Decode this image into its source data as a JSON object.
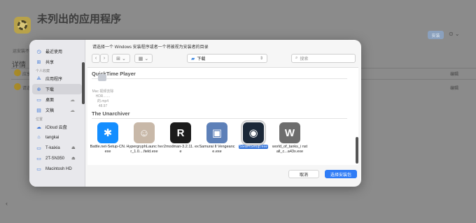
{
  "background": {
    "app_title": "未列出的应用程序",
    "install_label": "安装",
    "more_label": "⊙ ⌄",
    "side_small": "运安装不...",
    "section_title": "详情",
    "rows": [
      {
        "text": "应享...",
        "edit": "编辑"
      },
      {
        "text": "请选...",
        "edit": "编辑"
      }
    ],
    "back": "‹"
  },
  "dialog": {
    "title": "请选择一个 Windows 安装程序或者一个将被视为安装者的目录",
    "location": "下载",
    "search_placeholder": "搜索",
    "view_icons": [
      "‹",
      "›",
      "⊞ ⌄",
      "▦ ⌄"
    ],
    "cancel_label": "取消",
    "choose_label": "选择安装包"
  },
  "sidebar": {
    "items_top": [
      {
        "label": "最近使用",
        "icon": "clock-icon",
        "glyph": "◷"
      },
      {
        "label": "共享",
        "icon": "shared-icon",
        "glyph": "⊞"
      }
    ],
    "favorites_head": "个人收藏",
    "favorites": [
      {
        "label": "应用程序",
        "icon": "apps-icon",
        "glyph": "⟁"
      },
      {
        "label": "下载",
        "icon": "download-icon",
        "glyph": "⊕",
        "selected": true
      },
      {
        "label": "桌面",
        "icon": "desktop-icon",
        "glyph": "▭",
        "cloud": true
      },
      {
        "label": "文稿",
        "icon": "document-icon",
        "glyph": "▤",
        "cloud": true
      }
    ],
    "locations_head": "位置",
    "locations": [
      {
        "label": "iCloud 云盘",
        "icon": "cloud-icon",
        "glyph": "☁"
      },
      {
        "label": "tangkai",
        "icon": "home-icon",
        "glyph": "⌂"
      },
      {
        "label": "T-kaixia",
        "icon": "drive-icon",
        "glyph": "▭",
        "eject": true
      },
      {
        "label": "2T-SN350",
        "icon": "drive-icon",
        "glyph": "▭",
        "eject": true
      },
      {
        "label": "Macintosh HD",
        "icon": "drive-icon",
        "glyph": "▭"
      }
    ]
  },
  "content": {
    "group1": "QuickTime Player",
    "partial_file": "Mac 视频去除 HDR……的.mp4",
    "partial_caption": "48.97",
    "group2": "The Unarchiver",
    "files": [
      {
        "name": "Battle.net-Setup-CN.exe",
        "icon": "battlenet-icon",
        "glyph": "✱",
        "color": "#148eff"
      },
      {
        "name": "HypergryphLaunc her_1.0....field.exe",
        "icon": "hypergryph-icon",
        "glyph": "☺",
        "color": "#c8b8a8"
      },
      {
        "name": "r2modman-3.2.11. exe",
        "icon": "r2modman-icon",
        "glyph": "R",
        "color": "#1c1c1c"
      },
      {
        "name": "Samurai II Vengeance.exe",
        "icon": "installer-icon",
        "glyph": "▣",
        "color": "#5d80b8"
      },
      {
        "name": "SteamSetup.exe",
        "icon": "steam-icon",
        "glyph": "◉",
        "color": "#1b2838",
        "selected": true
      },
      {
        "name": "world_of_tanks_i nstall_c...a43x.exe",
        "icon": "wot-icon",
        "glyph": "W",
        "color": "#6d6d6d"
      }
    ]
  }
}
